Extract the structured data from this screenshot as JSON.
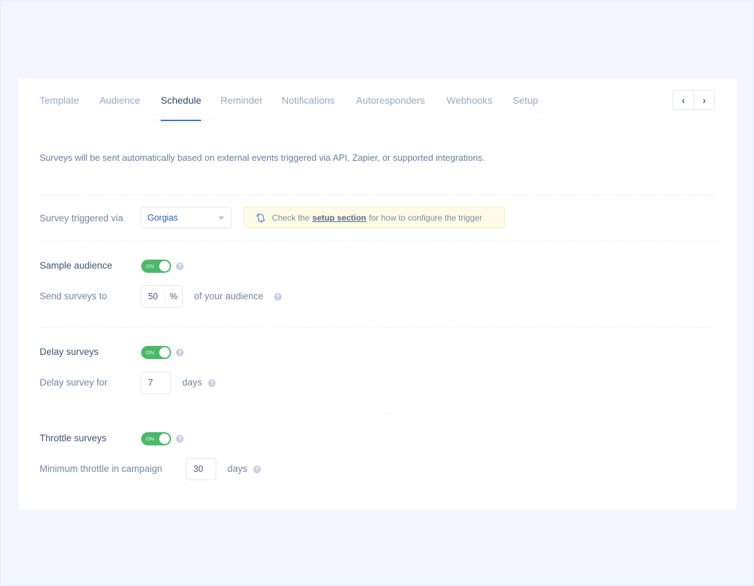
{
  "tabs": [
    {
      "label": "Template",
      "active": false
    },
    {
      "label": "Audience",
      "active": false
    },
    {
      "label": "Schedule",
      "active": true
    },
    {
      "label": "Reminder",
      "active": false
    },
    {
      "label": "Notifications",
      "active": false
    },
    {
      "label": "Autoresponders",
      "active": false
    },
    {
      "label": "Webhooks",
      "active": false
    },
    {
      "label": "Setup",
      "active": false
    }
  ],
  "pager": {
    "prev": "‹",
    "next": "›"
  },
  "description": "Surveys will be sent automatically based on external events triggered via API, Zapier, or supported integrations.",
  "trigger": {
    "label": "Survey triggered via",
    "selected": "Gorgias",
    "notice_prefix": "Check the",
    "notice_link": "setup section",
    "notice_suffix": "for how to configure the trigger",
    "notice_icon": "bell-icon"
  },
  "sample_audience": {
    "label": "Sample audience",
    "toggle": "ON",
    "enabled": true,
    "send_label": "Send surveys to",
    "value": "50",
    "unit": "%",
    "suffix": "of your audience"
  },
  "delay": {
    "label": "Delay surveys",
    "toggle": "ON",
    "enabled": true,
    "field_label": "Delay survey for",
    "value": "7",
    "suffix": "days"
  },
  "throttle": {
    "label": "Throttle surveys",
    "toggle": "ON",
    "enabled": true,
    "field_label": "Minimum throttle in campaign",
    "value": "30",
    "suffix": "days"
  },
  "help_glyph": "?",
  "colors": {
    "accent": "#3d72d6",
    "toggle_on": "#4db86a",
    "notice_bg": "#fdfbe6",
    "page_bg": "#f3f7fd"
  }
}
